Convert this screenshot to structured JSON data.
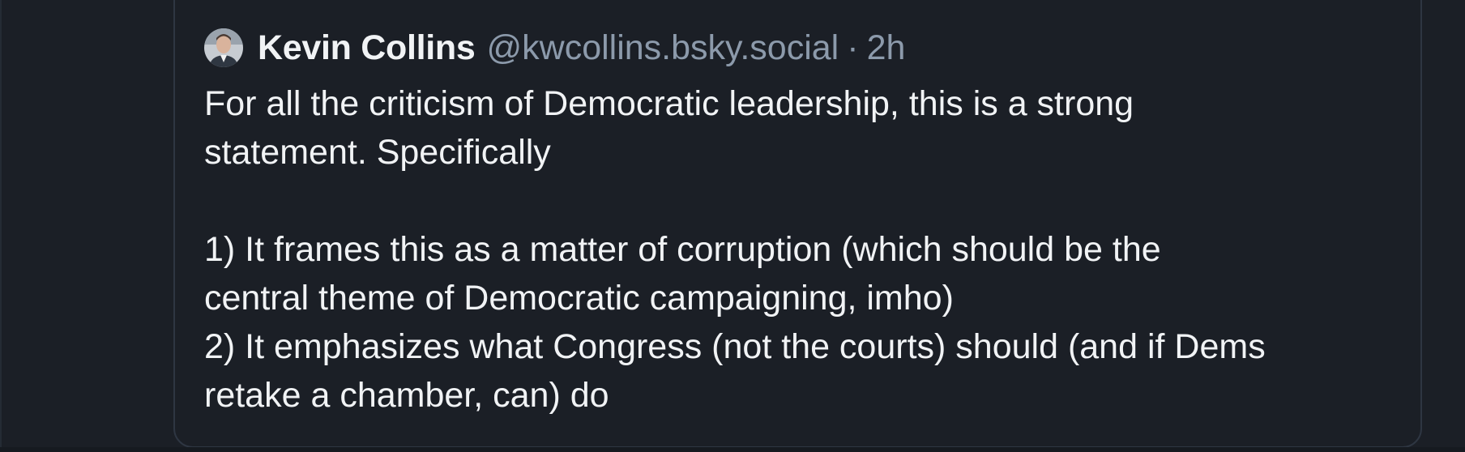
{
  "post": {
    "author": {
      "display_name": "Kevin Collins",
      "handle": "@kwcollins.bsky.social"
    },
    "separator": "·",
    "time_ago": "2h",
    "text_lines": [
      "For all the criticism of Democratic leadership, this is a strong",
      "statement. Specifically",
      "",
      "1) It frames this as a matter of corruption (which should be the",
      "central theme of Democratic campaigning, imho)",
      "2) It emphasizes what Congress (not the courts) should (and if Dems",
      "retake a chamber, can) do"
    ]
  },
  "colors": {
    "background": "#1b1f26",
    "card_border": "#2e3642",
    "primary_text": "#f1f3f5",
    "secondary_text": "#8c9aab"
  }
}
